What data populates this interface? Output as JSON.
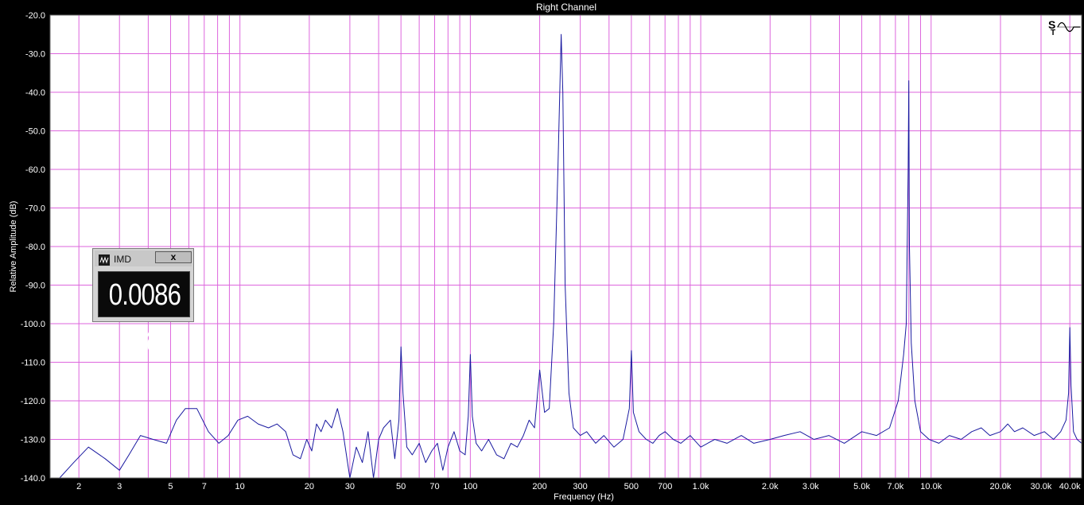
{
  "chart_data": {
    "type": "line",
    "title": "Right Channel",
    "xlabel": "Frequency (Hz)",
    "ylabel": "Relative Amplitude (dB)",
    "x_scale": "log",
    "xlim": [
      1.5,
      45000
    ],
    "ylim": [
      -140,
      -20
    ],
    "grid": true,
    "x_ticks": [
      {
        "value": 2,
        "label": "2"
      },
      {
        "value": 3,
        "label": "3"
      },
      {
        "value": 5,
        "label": "5"
      },
      {
        "value": 7,
        "label": "7"
      },
      {
        "value": 10,
        "label": "10"
      },
      {
        "value": 20,
        "label": "20"
      },
      {
        "value": 30,
        "label": "30"
      },
      {
        "value": 50,
        "label": "50"
      },
      {
        "value": 70,
        "label": "70"
      },
      {
        "value": 100,
        "label": "100"
      },
      {
        "value": 200,
        "label": "200"
      },
      {
        "value": 300,
        "label": "300"
      },
      {
        "value": 500,
        "label": "500"
      },
      {
        "value": 700,
        "label": "700"
      },
      {
        "value": 1000,
        "label": "1.0k"
      },
      {
        "value": 2000,
        "label": "2.0k"
      },
      {
        "value": 3000,
        "label": "3.0k"
      },
      {
        "value": 5000,
        "label": "5.0k"
      },
      {
        "value": 7000,
        "label": "7.0k"
      },
      {
        "value": 10000,
        "label": "10.0k"
      },
      {
        "value": 20000,
        "label": "20.0k"
      },
      {
        "value": 30000,
        "label": "30.0k"
      },
      {
        "value": 40000,
        "label": "40.0k"
      }
    ],
    "y_ticks": [
      {
        "value": -20,
        "label": "-20.0"
      },
      {
        "value": -30,
        "label": "-30.0"
      },
      {
        "value": -40,
        "label": "-40.0"
      },
      {
        "value": -50,
        "label": "-50.0"
      },
      {
        "value": -60,
        "label": "-60.0"
      },
      {
        "value": -70,
        "label": "-70.0"
      },
      {
        "value": -80,
        "label": "-80.0"
      },
      {
        "value": -90,
        "label": "-90.0"
      },
      {
        "value": -100,
        "label": "-100.0"
      },
      {
        "value": -110,
        "label": "-110.0"
      },
      {
        "value": -120,
        "label": "-120.0"
      },
      {
        "value": -130,
        "label": "-130.0"
      },
      {
        "value": -140,
        "label": "-140.0"
      }
    ],
    "series": [
      {
        "color": "#1a1aa0",
        "x": [
          1.5,
          1.65,
          1.9,
          2.2,
          2.6,
          3.0,
          3.3,
          3.7,
          4.2,
          4.8,
          5.3,
          5.8,
          6.5,
          7.3,
          8.1,
          8.9,
          9.8,
          10.8,
          12.0,
          13.3,
          14.5,
          15.8,
          17.0,
          18.3,
          19.5,
          20.5,
          21.5,
          22.5,
          23.5,
          25,
          26.5,
          28,
          30,
          32,
          34,
          36,
          38,
          40,
          42,
          45,
          47,
          49,
          50,
          51,
          53,
          56,
          60,
          64,
          68,
          72,
          76,
          80,
          85,
          90,
          95,
          98,
          100,
          102,
          106,
          112,
          120,
          130,
          140,
          150,
          160,
          170,
          180,
          190,
          200,
          210,
          220,
          230,
          240,
          248,
          252,
          258,
          268,
          280,
          300,
          320,
          350,
          380,
          420,
          460,
          490,
          500,
          510,
          540,
          580,
          620,
          660,
          700,
          760,
          820,
          900,
          1000,
          1150,
          1300,
          1500,
          1700,
          2000,
          2300,
          2700,
          3100,
          3600,
          4200,
          5000,
          5800,
          6600,
          7200,
          7600,
          7800,
          7950,
          8000,
          8050,
          8200,
          8500,
          9000,
          9800,
          10800,
          12000,
          13500,
          15000,
          16500,
          18000,
          20000,
          21500,
          23000,
          25000,
          28000,
          31000,
          34000,
          36500,
          38500,
          39500,
          40000,
          40500,
          41500,
          43000,
          45000
        ],
        "values": [
          -140,
          -140,
          -136,
          -132,
          -135,
          -138,
          -134,
          -129,
          -130,
          -131,
          -125,
          -122,
          -122,
          -128,
          -131,
          -129,
          -125,
          -124,
          -126,
          -127,
          -126,
          -128,
          -134,
          -135,
          -130,
          -133,
          -126,
          -128,
          -125,
          -127,
          -122,
          -128,
          -140,
          -132,
          -136,
          -128,
          -140,
          -130,
          -127,
          -125,
          -135,
          -125,
          -106,
          -118,
          -132,
          -134,
          -131,
          -136,
          -133,
          -131,
          -138,
          -132,
          -128,
          -133,
          -134,
          -124,
          -108,
          -124,
          -131,
          -133,
          -130,
          -134,
          -135,
          -131,
          -132,
          -129,
          -125,
          -127,
          -112,
          -123,
          -122,
          -100,
          -60,
          -25,
          -40,
          -90,
          -118,
          -127,
          -129,
          -128,
          -131,
          -129,
          -132,
          -130,
          -122,
          -107,
          -123,
          -128,
          -130,
          -131,
          -129,
          -128,
          -130,
          -131,
          -129,
          -132,
          -130,
          -131,
          -129,
          -131,
          -130,
          -129,
          -128,
          -130,
          -129,
          -131,
          -128,
          -129,
          -127,
          -120,
          -108,
          -100,
          -60,
          -37,
          -80,
          -105,
          -120,
          -128,
          -130,
          -131,
          -129,
          -130,
          -128,
          -127,
          -129,
          -128,
          -126,
          -128,
          -127,
          -129,
          -128,
          -130,
          -128,
          -125,
          -118,
          -101,
          -116,
          -128,
          -130,
          -131
        ]
      }
    ]
  },
  "controls": {
    "corner_tool_icon": "signal-generator-icon"
  },
  "imd_window": {
    "title": "IMD",
    "close_label": "x",
    "value": "0.0086 %"
  }
}
